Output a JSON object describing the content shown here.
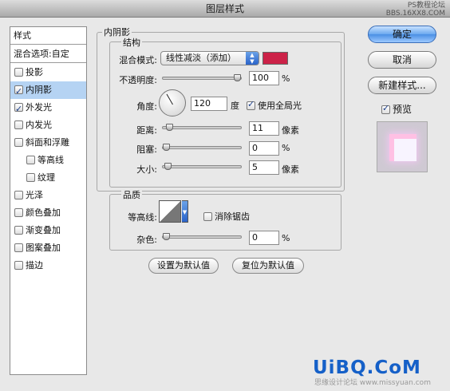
{
  "window": {
    "title": "图层样式"
  },
  "watermark_top": {
    "line1": "PS教程论坛",
    "line2": "BBS.16XX8.COM"
  },
  "stylelist": {
    "header": "样式",
    "blend": "混合选项:自定",
    "items": [
      {
        "label": "投影",
        "checked": false
      },
      {
        "label": "内阴影",
        "checked": true
      },
      {
        "label": "外发光",
        "checked": true
      },
      {
        "label": "内发光",
        "checked": false
      },
      {
        "label": "斜面和浮雕",
        "checked": false
      },
      {
        "label": "等高线",
        "checked": false
      },
      {
        "label": "纹理",
        "checked": false
      },
      {
        "label": "光泽",
        "checked": false
      },
      {
        "label": "颜色叠加",
        "checked": false
      },
      {
        "label": "渐变叠加",
        "checked": false
      },
      {
        "label": "图案叠加",
        "checked": false
      },
      {
        "label": "描边",
        "checked": false
      }
    ]
  },
  "inner_shadow": {
    "title": "内阴影",
    "structure_title": "结构",
    "blend_mode_label": "混合模式:",
    "blend_mode_value": "线性减淡（添加）",
    "color": "#cc2248",
    "opacity_label": "不透明度:",
    "opacity_value": "100",
    "opacity_unit": "%",
    "opacity_fraction": 1.0,
    "angle_label": "角度:",
    "angle_value": "120",
    "angle_unit": "度",
    "global_light_label": "使用全局光",
    "distance_label": "距离:",
    "distance_value": "11",
    "distance_unit": "像素",
    "distance_fraction": 0.05,
    "choke_label": "阻塞:",
    "choke_value": "0",
    "choke_unit": "%",
    "choke_fraction": 0.0,
    "size_label": "大小:",
    "size_value": "5",
    "size_unit": "像素",
    "size_fraction": 0.02
  },
  "quality": {
    "title": "品质",
    "contour_label": "等高线:",
    "antialias_label": "消除锯齿",
    "noise_label": "杂色:",
    "noise_value": "0",
    "noise_unit": "%",
    "noise_fraction": 0.0
  },
  "buttons": {
    "set_default": "设置为默认值",
    "reset_default": "复位为默认值",
    "ok": "确定",
    "cancel": "取消",
    "new_style": "新建样式...",
    "preview_label": "预览"
  },
  "watermark_bottom": {
    "brand": "UiBQ.CoM",
    "sub": "思缘设计论坛 www.missyuan.com"
  }
}
